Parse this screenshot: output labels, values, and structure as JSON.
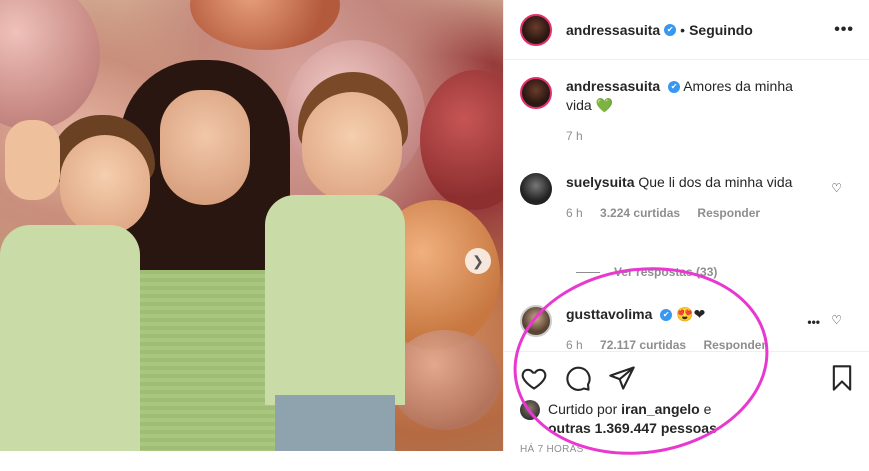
{
  "post": {
    "photo_alt": "",
    "next_icon": "chevron-right"
  },
  "header": {
    "username": "andressasuita",
    "separator": "•",
    "follow_status": "Seguindo",
    "more": "•••"
  },
  "caption": {
    "username": "andressasuita",
    "text": "Amores da minha vida 💚",
    "time": "7 h"
  },
  "comments": [
    {
      "username": "suelysuita",
      "text": "Que li dos da minha vida",
      "time": "6 h",
      "likes": "3.224 curtidas",
      "reply": "Responder"
    },
    {
      "username": "gusttavolima",
      "text": "😍❤",
      "time": "6 h",
      "likes": "72.117 curtidas",
      "reply": "Responder"
    }
  ],
  "view_replies": "Ver respostas (33)",
  "comment_more": "•••",
  "liked_by": {
    "prefix": "Curtido por",
    "user": "iran_angelo",
    "suffix": "e",
    "others": "outras 1.369.447 pessoas"
  },
  "timestamp": "HÁ 7 HORAS",
  "colors": {
    "annotation": "#e838d0",
    "verified": "#3897f0",
    "heart": "#262626"
  }
}
